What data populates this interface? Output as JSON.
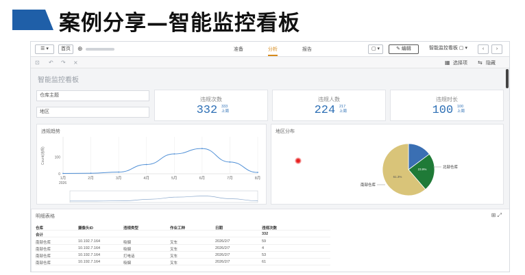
{
  "slide": {
    "title": "案例分享—智能监控看板"
  },
  "topbar": {
    "menu_btn": "☰ ▾",
    "home_btn": "首页",
    "tabs": [
      "准备",
      "分析",
      "报告"
    ],
    "active_tab": 1,
    "bookmark_btn": "▢ ▾",
    "edit_btn": "✎ 编辑",
    "sheet_name": "智能监控看板 ▢ ▾",
    "prev": "‹",
    "next": "›"
  },
  "toolbar2": {
    "right_a": "选择项",
    "right_b": "隐藏"
  },
  "dashboard": {
    "title": "智能监控看板",
    "filters": [
      "仓库主题",
      "地区"
    ],
    "kpis": [
      {
        "label": "违规次数",
        "value": "332",
        "sub_top": "333",
        "sub_bottom": "上周"
      },
      {
        "label": "违规人数",
        "value": "224",
        "sub_top": "217",
        "sub_bottom": "上周"
      },
      {
        "label": "违规时长",
        "value": "100",
        "sub_top": "100",
        "sub_bottom": "上周"
      }
    ]
  },
  "trend_panel": {
    "title": "违规趋势"
  },
  "dist_panel": {
    "title": "地区分布",
    "label_a": "北部仓库",
    "label_b": "南部仓库"
  },
  "detail_panel": {
    "title": "明细表格",
    "columns": [
      "仓库",
      "摄像头ID",
      "违规类型",
      "作业工种",
      "日期",
      "违规次数"
    ],
    "total_label": "合计",
    "total_value": "332",
    "rows": [
      [
        "南部仓库",
        "10.192.7.164",
        "吸烟",
        "叉车",
        "2026/2/7",
        "59"
      ],
      [
        "南部仓库",
        "10.192.7.164",
        "吸烟",
        "叉车",
        "2026/2/7",
        "4"
      ],
      [
        "南部仓库",
        "10.192.7.164",
        "打电话",
        "叉车",
        "2026/2/7",
        "53"
      ],
      [
        "南部仓库",
        "10.192.7.164",
        "吸烟",
        "叉车",
        "2026/2/7",
        "61"
      ]
    ]
  },
  "chart_data": [
    {
      "type": "line",
      "title": "违规趋势",
      "ylabel": "Count(违规)",
      "x": [
        "1月",
        "2月",
        "3月",
        "4月",
        "5月",
        "6月",
        "7月",
        "8月"
      ],
      "x_sub": "2026",
      "values": [
        2,
        3,
        10,
        55,
        118,
        150,
        70,
        8
      ],
      "ylim": [
        0,
        220
      ],
      "yticks": [
        0,
        100
      ]
    },
    {
      "type": "pie",
      "title": "地区分布",
      "slices": [
        {
          "label": "南部仓库",
          "value": 61.3,
          "color": "#d9c479"
        },
        {
          "label": "北部仓库",
          "value": 23.9,
          "color": "#1f7a37"
        },
        {
          "label": "",
          "value": 14.8,
          "color": "#3a6fb3"
        }
      ],
      "inner_labels": [
        "23.9%",
        "61.3%"
      ]
    }
  ],
  "colors": {
    "accent": "#1f5fa8",
    "kpi": "#2d6fb5",
    "active_tab": "#d68a1a",
    "line": "#4f8fd6"
  }
}
